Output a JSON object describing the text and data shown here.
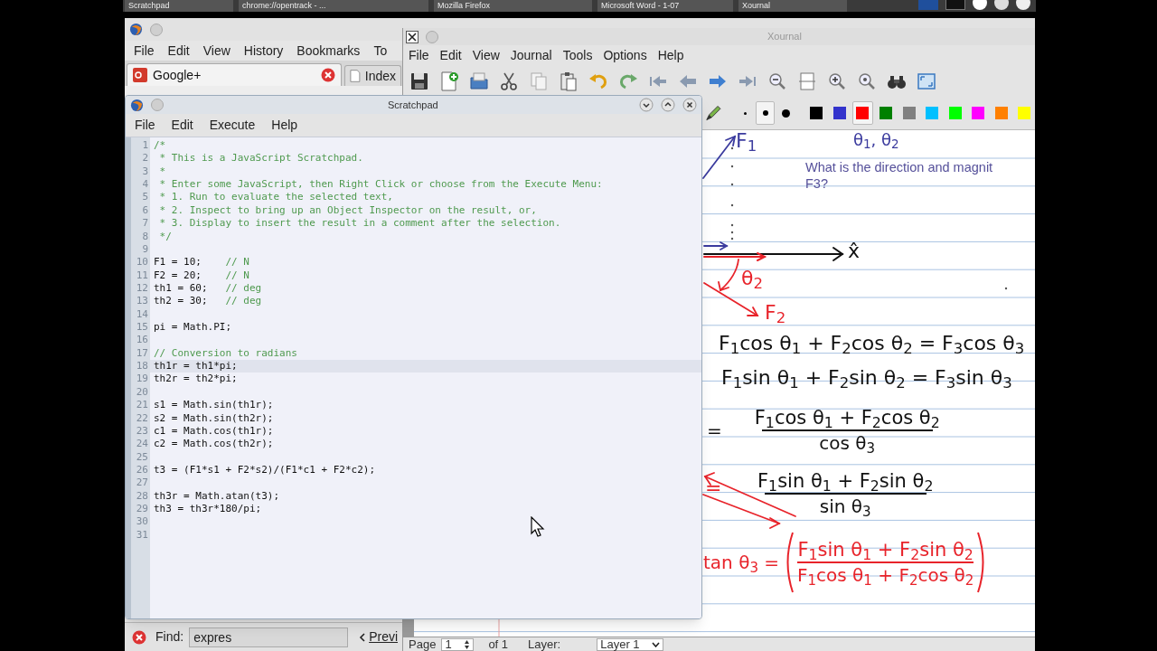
{
  "taskbar": {
    "items": [
      {
        "label": "Scratchpad"
      },
      {
        "label": "chrome://opentrack - ..."
      },
      {
        "label": "Mozilla Firefox"
      },
      {
        "label": "Microsoft Word - 1-07"
      },
      {
        "label": "Xournal"
      }
    ]
  },
  "firefox_window": {
    "menu": [
      "File",
      "Edit",
      "View",
      "History",
      "Bookmarks",
      "To"
    ],
    "tabs": [
      {
        "label": "Google+",
        "selected": true
      },
      {
        "label": "Index",
        "selected": false
      }
    ],
    "find_bar": {
      "label": "Find:",
      "value": "expres",
      "previous_button": "Previ"
    }
  },
  "xournal_window": {
    "title": "Xournal",
    "menu": [
      "File",
      "Edit",
      "View",
      "Journal",
      "Tools",
      "Options",
      "Help"
    ],
    "pen_sizes": [
      {
        "selected": false
      },
      {
        "selected": true
      },
      {
        "selected": false
      }
    ],
    "pen_colors": [
      {
        "color": "#000000",
        "selected": false
      },
      {
        "color": "#3333cc",
        "selected": false
      },
      {
        "color": "#ff0000",
        "selected": true
      },
      {
        "color": "#008000",
        "selected": false
      },
      {
        "color": "#808080",
        "selected": false
      },
      {
        "color": "#00c0ff",
        "selected": false
      },
      {
        "color": "#00ff00",
        "selected": false
      },
      {
        "color": "#ff00ff",
        "selected": false
      },
      {
        "color": "#ff8000",
        "selected": false
      },
      {
        "color": "#ffff00",
        "selected": false
      }
    ],
    "page": {
      "heading": "θ$_{1}$, θ$_{2}$",
      "question": [
        "What is the direction and magnit",
        "F3?"
      ],
      "labels": [
        {
          "text": "F$_{1}$",
          "color": "#3b3b9e"
        },
        {
          "text": "x̂",
          "color": "#111111"
        },
        {
          "text": "θ$_{2}$",
          "color": "#e8232a"
        },
        {
          "text": "F$_{2}$",
          "color": "#e8232a"
        },
        {
          "text": "=",
          "color": "#e8232a"
        }
      ],
      "equations": [
        {
          "kind": "line",
          "color": "#111111",
          "text": "F$_{1}$cos θ$_{1}$ + F$_{2}$cos θ$_{2}$ = F$_{3}$cos θ$_{3}$"
        },
        {
          "kind": "line",
          "color": "#111111",
          "text": "F$_{1}$sin θ$_{1}$ + F$_{2}$sin θ$_{2}$ = F$_{3}$sin θ$_{3}$"
        },
        {
          "kind": "fraction",
          "color": "#111111",
          "prefix": "=",
          "numerator": "F$_{1}$cos θ$_{1}$ + F$_{2}$cos θ$_{2}$",
          "denominator": "cos θ$_{3}$",
          "parenthesized": false
        },
        {
          "kind": "fraction",
          "color": "#111111",
          "numerator": "F$_{1}$sin θ$_{1}$ + F$_{2}$sin θ$_{2}$",
          "denominator": "sin θ$_{3}$",
          "parenthesized": false
        },
        {
          "kind": "fraction",
          "color": "#e8232a",
          "prefix": "tan θ$_{3}$ =",
          "numerator": "F$_{1}$sin θ$_{1}$ + F$_{2}$sin θ$_{2}$",
          "denominator": "F$_{1}$cos θ$_{1}$ + F$_{2}$cos θ$_{2}$",
          "parenthesized": true
        }
      ]
    },
    "status_bar": {
      "page_label": "Page",
      "page_value": "1",
      "page_total": "of 1",
      "layer_label": "Layer:",
      "layer_value": "Layer 1"
    }
  },
  "scratchpad_window": {
    "title": "Scratchpad",
    "menu": [
      "File",
      "Edit",
      "Execute",
      "Help"
    ],
    "lines": [
      {
        "number": "1",
        "comment": "/*",
        "selected": false
      },
      {
        "number": "2",
        "comment": " * This is a JavaScript Scratchpad.",
        "selected": false
      },
      {
        "number": "3",
        "comment": " *",
        "selected": false
      },
      {
        "number": "4",
        "comment": " * Enter some JavaScript, then Right Click or choose from the Execute Menu:",
        "selected": false
      },
      {
        "number": "5",
        "comment": " * 1. Run to evaluate the selected text,",
        "selected": false
      },
      {
        "number": "6",
        "comment": " * 2. Inspect to bring up an Object Inspector on the result, or,",
        "selected": false
      },
      {
        "number": "7",
        "comment": " * 3. Display to insert the result in a comment after the selection.",
        "selected": false
      },
      {
        "number": "8",
        "comment": " */",
        "selected": false
      },
      {
        "number": "9",
        "selected": false
      },
      {
        "number": "10",
        "code": "F1 = 10;",
        "comment": "    // N",
        "selected": false
      },
      {
        "number": "11",
        "code": "F2 = 20;",
        "comment": "    // N",
        "selected": false
      },
      {
        "number": "12",
        "code": "th1 = 60;",
        "comment": "   // deg",
        "selected": false
      },
      {
        "number": "13",
        "code": "th2 = 30;",
        "comment": "   // deg",
        "selected": false
      },
      {
        "number": "14",
        "selected": false
      },
      {
        "number": "15",
        "code": "pi = Math.PI;",
        "selected": false
      },
      {
        "number": "16",
        "selected": false
      },
      {
        "number": "17",
        "comment": "// Conversion to radians",
        "selected": false
      },
      {
        "number": "18",
        "code": "th1r = th1*pi;",
        "selected": true
      },
      {
        "number": "19",
        "code": "th2r = th2*pi;",
        "selected": false
      },
      {
        "number": "20",
        "selected": false
      },
      {
        "number": "21",
        "code": "s1 = Math.sin(th1r);",
        "selected": false
      },
      {
        "number": "22",
        "code": "s2 = Math.sin(th2r);",
        "selected": false
      },
      {
        "number": "23",
        "code": "c1 = Math.cos(th1r);",
        "selected": false
      },
      {
        "number": "24",
        "code": "c2 = Math.cos(th2r);",
        "selected": false
      },
      {
        "number": "25",
        "selected": false
      },
      {
        "number": "26",
        "code": "t3 = (F1*s1 + F2*s2)/(F1*c1 + F2*c2);",
        "selected": false
      },
      {
        "number": "27",
        "selected": false
      },
      {
        "number": "28",
        "code": "th3r = Math.atan(t3);",
        "selected": false
      },
      {
        "number": "29",
        "code": "th3 = th3r*180/pi;",
        "selected": false
      },
      {
        "number": "30",
        "selected": false
      },
      {
        "number": "31",
        "selected": false
      }
    ]
  }
}
